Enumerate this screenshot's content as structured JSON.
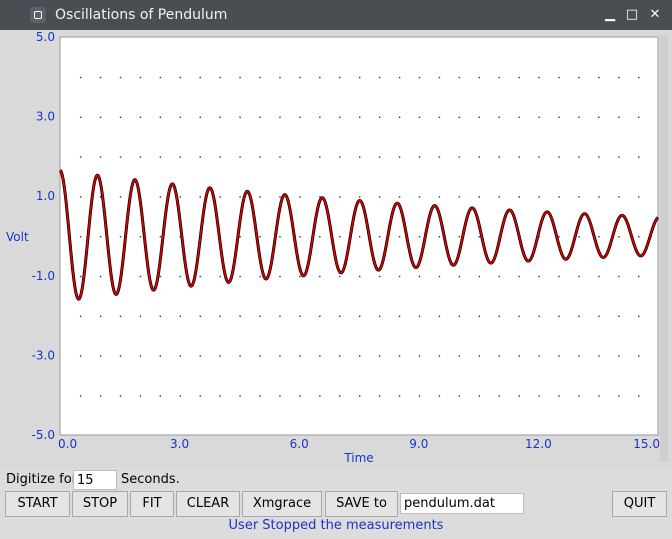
{
  "window": {
    "title": "Oscillations of Pendulum",
    "icon": "app-icon"
  },
  "window_controls": {
    "minimize": "▁",
    "maximize": "□",
    "close": "✕"
  },
  "chart_data": {
    "type": "line",
    "xlabel": "Time",
    "ylabel": "Volt",
    "xlim": [
      0,
      15
    ],
    "ylim": [
      -5,
      5
    ],
    "xticks": [
      "0.0",
      "3.0",
      "6.0",
      "9.0",
      "12.0",
      "15.0"
    ],
    "yticks": [
      "5.0",
      "3.0",
      "1.0",
      "-1.0",
      "-3.0",
      "-5.0"
    ],
    "grid": "dotted",
    "series": [
      {
        "color": "#000000",
        "model": {
          "A": 1.65,
          "decay": 0.082,
          "period": 0.94,
          "phase": 0.0,
          "offset": 0.0
        }
      },
      {
        "color": "#e00000",
        "model": {
          "A": 1.65,
          "decay": 0.082,
          "period": 0.94,
          "phase": 0.0,
          "offset": 0.0
        }
      }
    ]
  },
  "controls": {
    "digitize_label": "Digitize for",
    "digitize_value": "15",
    "seconds_label": "Seconds.",
    "start": "START",
    "stop": "STOP",
    "fit": "FIT",
    "clear": "CLEAR",
    "xmgrace": "Xmgrace",
    "save_to": "SAVE to",
    "filename": "pendulum.dat",
    "quit": "QUIT"
  },
  "status": "User Stopped the measurements"
}
